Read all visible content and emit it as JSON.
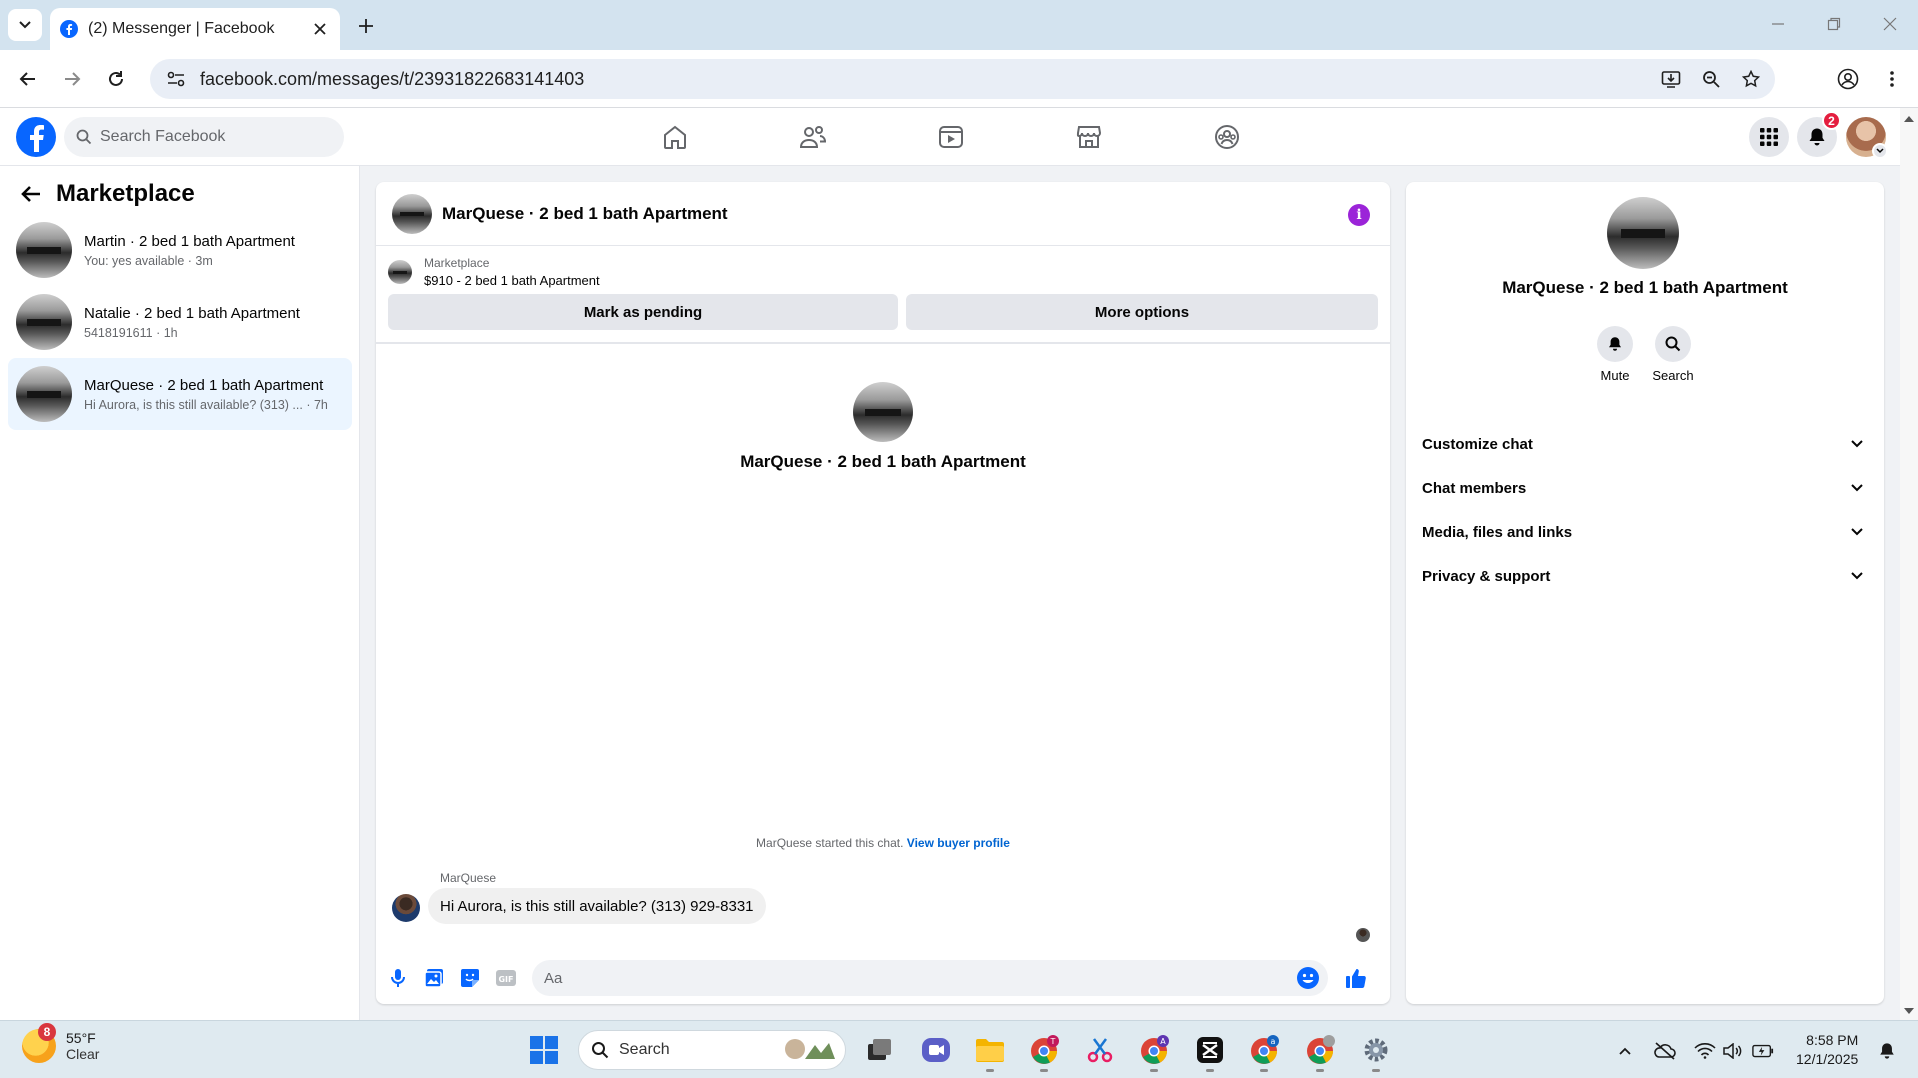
{
  "browser": {
    "tab_title": "(2) Messenger | Facebook",
    "url": "facebook.com/messages/t/23931822683141403"
  },
  "fb_header": {
    "search_placeholder": "Search Facebook",
    "notification_count": "2",
    "brand_color": "#0866ff"
  },
  "left_pane": {
    "title": "Marketplace",
    "chats": [
      {
        "name": "Martin · 2 bed 1 bath Apartment",
        "preview": "You: yes available · 3m"
      },
      {
        "name": "Natalie · 2 bed 1 bath Apartment",
        "preview": "5418191611 · 1h"
      },
      {
        "name": "MarQuese · 2 bed 1 bath Apartment",
        "preview": "Hi Aurora, is this still available? (313) ... · 7h"
      }
    ]
  },
  "conversation": {
    "title": "MarQuese · 2 bed 1 bath Apartment",
    "listing_source": "Marketplace",
    "listing_price": "$910 - 2 bed 1 bath Apartment",
    "mark_pending_label": "Mark as pending",
    "more_options_label": "More options",
    "hero_name": "MarQuese · 2 bed 1 bath Apartment",
    "started_text": "MarQuese started this chat.",
    "buyer_profile_link": "View buyer profile",
    "sender": "MarQuese",
    "message": "Hi Aurora, is this still available? (313) 929-8331",
    "composer_placeholder": "Aa"
  },
  "right_pane": {
    "name": "MarQuese · 2 bed 1 bath Apartment",
    "mute_label": "Mute",
    "search_label": "Search",
    "sections": [
      "Customize chat",
      "Chat members",
      "Media, files and links",
      "Privacy & support"
    ]
  },
  "taskbar": {
    "weather_badge": "8",
    "weather_temp": "55°F",
    "weather_condition": "Clear",
    "search_label": "Search",
    "time": "8:58 PM",
    "date": "12/1/2025"
  }
}
